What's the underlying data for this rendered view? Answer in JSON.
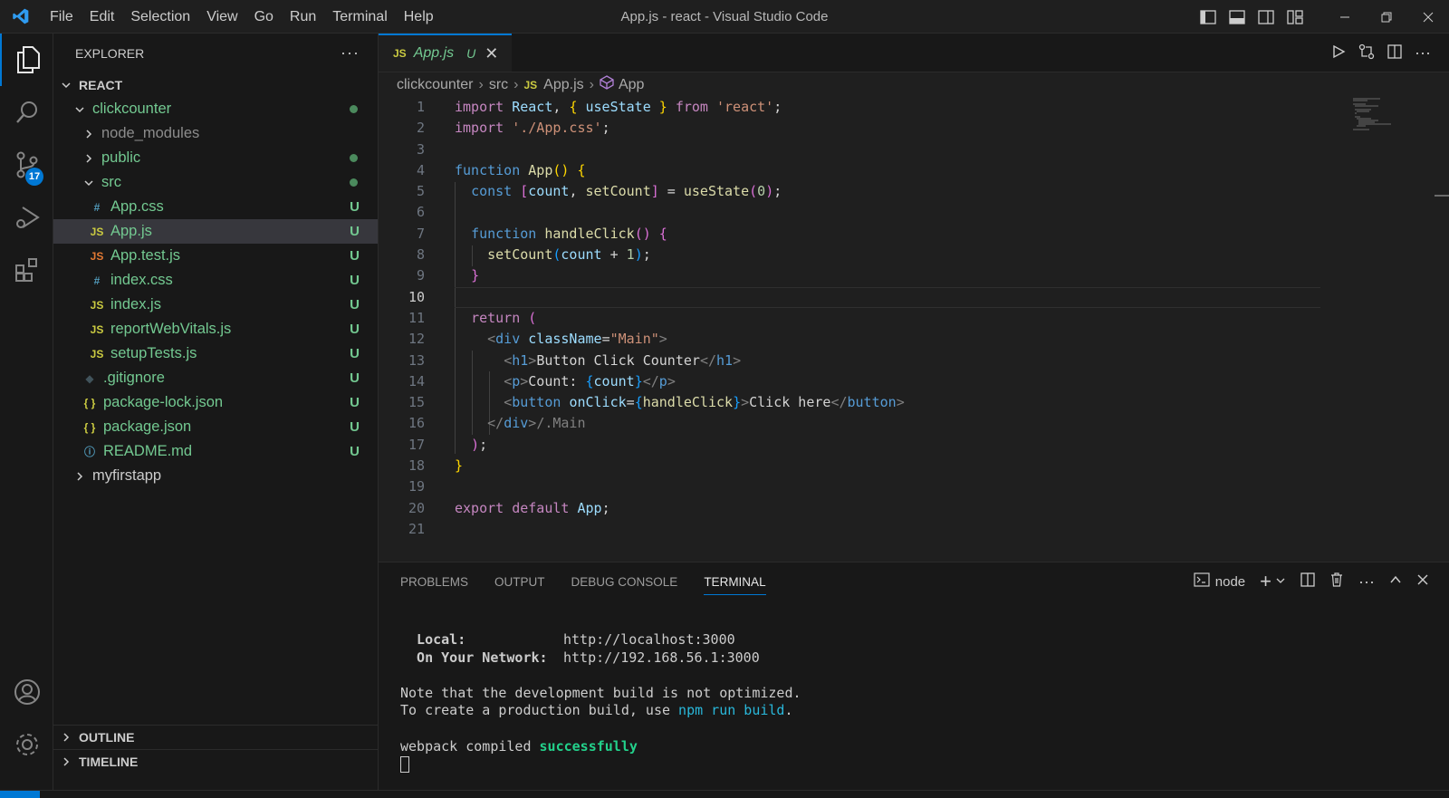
{
  "titlebar": {
    "menu": [
      "File",
      "Edit",
      "Selection",
      "View",
      "Go",
      "Run",
      "Terminal",
      "Help"
    ],
    "window_title": "App.js - react - Visual Studio Code",
    "layout_icons": [
      "toggle-primary-sidebar-icon",
      "toggle-panel-icon",
      "toggle-secondary-sidebar-icon",
      "customize-layout-icon"
    ],
    "window_controls": [
      "minimize-icon",
      "restore-icon",
      "close-icon"
    ]
  },
  "activitybar": {
    "items": [
      "explorer-icon",
      "search-icon",
      "source-control-icon",
      "run-debug-icon",
      "extensions-icon"
    ],
    "scm_badge": "17",
    "bottom": [
      "accounts-icon",
      "manage-gear-icon"
    ]
  },
  "sidebar": {
    "title": "EXPLORER",
    "more": "···",
    "root": "REACT",
    "tree": [
      {
        "label": "clickcounter",
        "kind": "folder-open",
        "depth": 1,
        "status": "dot"
      },
      {
        "label": "node_modules",
        "kind": "folder",
        "depth": 2,
        "status": ""
      },
      {
        "label": "public",
        "kind": "folder",
        "depth": 2,
        "status": "dot"
      },
      {
        "label": "src",
        "kind": "folder-open",
        "depth": 2,
        "status": "dot"
      },
      {
        "label": "App.css",
        "kind": "css",
        "icon": "#",
        "depth": 3,
        "status": "U"
      },
      {
        "label": "App.js",
        "kind": "js",
        "icon": "JS",
        "depth": 3,
        "status": "U",
        "selected": true
      },
      {
        "label": "App.test.js",
        "kind": "test",
        "icon": "JS",
        "depth": 3,
        "status": "U"
      },
      {
        "label": "index.css",
        "kind": "css",
        "icon": "#",
        "depth": 3,
        "status": "U"
      },
      {
        "label": "index.js",
        "kind": "js",
        "icon": "JS",
        "depth": 3,
        "status": "U"
      },
      {
        "label": "reportWebVitals.js",
        "kind": "js",
        "icon": "JS",
        "depth": 3,
        "status": "U"
      },
      {
        "label": "setupTests.js",
        "kind": "js",
        "icon": "JS",
        "depth": 3,
        "status": "U"
      },
      {
        "label": ".gitignore",
        "kind": "git",
        "icon": "◆",
        "depth": 2,
        "status": "U"
      },
      {
        "label": "package-lock.json",
        "kind": "json",
        "icon": "{ }",
        "depth": 2,
        "status": "U"
      },
      {
        "label": "package.json",
        "kind": "json",
        "icon": "{ }",
        "depth": 2,
        "status": "U"
      },
      {
        "label": "README.md",
        "kind": "info",
        "icon": "ⓘ",
        "depth": 2,
        "status": "U"
      },
      {
        "label": "myfirstapp",
        "kind": "folder",
        "depth": 1,
        "status": "",
        "plain": true
      }
    ],
    "outline": "OUTLINE",
    "timeline": "TIMELINE"
  },
  "editor": {
    "tab": {
      "icon": "JS",
      "name": "App.js",
      "modified": "U",
      "close": "✕"
    },
    "breadcrumb": [
      "clickcounter",
      "src",
      "App.js",
      "App"
    ],
    "breadcrumb_js_icon": "JS",
    "current_line": 10,
    "lines": [
      {
        "n": "1",
        "tokens": [
          [
            "kw",
            "import "
          ],
          [
            "v",
            "React"
          ],
          [
            "pl",
            ", "
          ],
          [
            "p1",
            "{ "
          ],
          [
            "v",
            "useState"
          ],
          [
            "p1",
            " }"
          ],
          [
            "kw",
            " from "
          ],
          [
            "s",
            "'react'"
          ],
          [
            "pl",
            ";"
          ]
        ]
      },
      {
        "n": "2",
        "tokens": [
          [
            "kw",
            "import "
          ],
          [
            "s",
            "'./App.css'"
          ],
          [
            "pl",
            ";"
          ]
        ]
      },
      {
        "n": "3",
        "tokens": []
      },
      {
        "n": "4",
        "tokens": [
          [
            "k",
            "function "
          ],
          [
            "f",
            "App"
          ],
          [
            "p1",
            "()"
          ],
          [
            "pl",
            " "
          ],
          [
            "p1",
            "{"
          ]
        ]
      },
      {
        "n": "5",
        "tokens": [
          [
            "pl",
            "  "
          ],
          [
            "k",
            "const "
          ],
          [
            "p2",
            "["
          ],
          [
            "v",
            "count"
          ],
          [
            "pl",
            ", "
          ],
          [
            "f",
            "setCount"
          ],
          [
            "p2",
            "]"
          ],
          [
            "pl",
            " = "
          ],
          [
            "f",
            "useState"
          ],
          [
            "p2",
            "("
          ],
          [
            "n",
            "0"
          ],
          [
            "p2",
            ")"
          ],
          [
            "pl",
            ";"
          ]
        ]
      },
      {
        "n": "6",
        "tokens": []
      },
      {
        "n": "7",
        "tokens": [
          [
            "pl",
            "  "
          ],
          [
            "k",
            "function "
          ],
          [
            "f",
            "handleClick"
          ],
          [
            "p2",
            "()"
          ],
          [
            "pl",
            " "
          ],
          [
            "p2",
            "{"
          ]
        ]
      },
      {
        "n": "8",
        "tokens": [
          [
            "pl",
            "    "
          ],
          [
            "f",
            "setCount"
          ],
          [
            "p3",
            "("
          ],
          [
            "v",
            "count"
          ],
          [
            "pl",
            " + "
          ],
          [
            "n",
            "1"
          ],
          [
            "p3",
            ")"
          ],
          [
            "pl",
            ";"
          ]
        ]
      },
      {
        "n": "9",
        "tokens": [
          [
            "pl",
            "  "
          ],
          [
            "p2",
            "}"
          ]
        ]
      },
      {
        "n": "10",
        "tokens": []
      },
      {
        "n": "11",
        "tokens": [
          [
            "pl",
            "  "
          ],
          [
            "kw",
            "return "
          ],
          [
            "p2",
            "("
          ]
        ]
      },
      {
        "n": "12",
        "tokens": [
          [
            "pl",
            "    "
          ],
          [
            "ang",
            "<"
          ],
          [
            "t",
            "div "
          ],
          [
            "v",
            "className"
          ],
          [
            "pl",
            "="
          ],
          [
            "s",
            "\"Main\""
          ],
          [
            "ang",
            ">"
          ]
        ]
      },
      {
        "n": "13",
        "tokens": [
          [
            "pl",
            "      "
          ],
          [
            "ang",
            "<"
          ],
          [
            "t",
            "h1"
          ],
          [
            "ang",
            ">"
          ],
          [
            "pl",
            "Button Click Counter"
          ],
          [
            "ang",
            "</"
          ],
          [
            "t",
            "h1"
          ],
          [
            "ang",
            ">"
          ]
        ]
      },
      {
        "n": "14",
        "tokens": [
          [
            "pl",
            "      "
          ],
          [
            "ang",
            "<"
          ],
          [
            "t",
            "p"
          ],
          [
            "ang",
            ">"
          ],
          [
            "pl",
            "Count: "
          ],
          [
            "p3",
            "{"
          ],
          [
            "v",
            "count"
          ],
          [
            "p3",
            "}"
          ],
          [
            "ang",
            "</"
          ],
          [
            "t",
            "p"
          ],
          [
            "ang",
            ">"
          ]
        ]
      },
      {
        "n": "15",
        "tokens": [
          [
            "pl",
            "      "
          ],
          [
            "ang",
            "<"
          ],
          [
            "t",
            "button "
          ],
          [
            "v",
            "onClick"
          ],
          [
            "pl",
            "="
          ],
          [
            "p3",
            "{"
          ],
          [
            "f",
            "handleClick"
          ],
          [
            "p3",
            "}"
          ],
          [
            "ang",
            ">"
          ],
          [
            "pl",
            "Click here"
          ],
          [
            "ang",
            "</"
          ],
          [
            "t",
            "button"
          ],
          [
            "ang",
            ">"
          ]
        ]
      },
      {
        "n": "16",
        "tokens": [
          [
            "pl",
            "    "
          ],
          [
            "ang",
            "</"
          ],
          [
            "t",
            "div"
          ],
          [
            "ang",
            ">"
          ],
          [
            "ang",
            "/.Main"
          ]
        ]
      },
      {
        "n": "17",
        "tokens": [
          [
            "pl",
            "  "
          ],
          [
            "p2",
            ")"
          ],
          [
            "pl",
            ";"
          ]
        ]
      },
      {
        "n": "18",
        "tokens": [
          [
            "p1",
            "}"
          ]
        ]
      },
      {
        "n": "19",
        "tokens": []
      },
      {
        "n": "20",
        "tokens": [
          [
            "kw",
            "export "
          ],
          [
            "kw",
            "default "
          ],
          [
            "v",
            "App"
          ],
          [
            "pl",
            ";"
          ]
        ]
      },
      {
        "n": "21",
        "tokens": []
      }
    ],
    "actions": [
      "run-icon",
      "compare-changes-icon",
      "split-editor-icon",
      "more-actions-icon"
    ]
  },
  "panel": {
    "tabs": [
      "PROBLEMS",
      "OUTPUT",
      "DEBUG CONSOLE",
      "TERMINAL"
    ],
    "active_tab": "TERMINAL",
    "terminal_name": "node",
    "terminal": {
      "local_label": "  Local:",
      "local_url": "http://localhost:3000",
      "network_label": "  On Your Network:",
      "network_url": "http://192.168.56.1:3000",
      "note1": "Note that the development build is not optimized.",
      "note2_prefix": "To create a production build, use ",
      "note2_cmd": "npm run build",
      "note2_suffix": ".",
      "compiled_prefix": "webpack compiled ",
      "compiled_status": "successfully"
    }
  },
  "colors": {
    "accent": "#0078d4",
    "untracked": "#73c991",
    "background": "#1f1f1f"
  }
}
